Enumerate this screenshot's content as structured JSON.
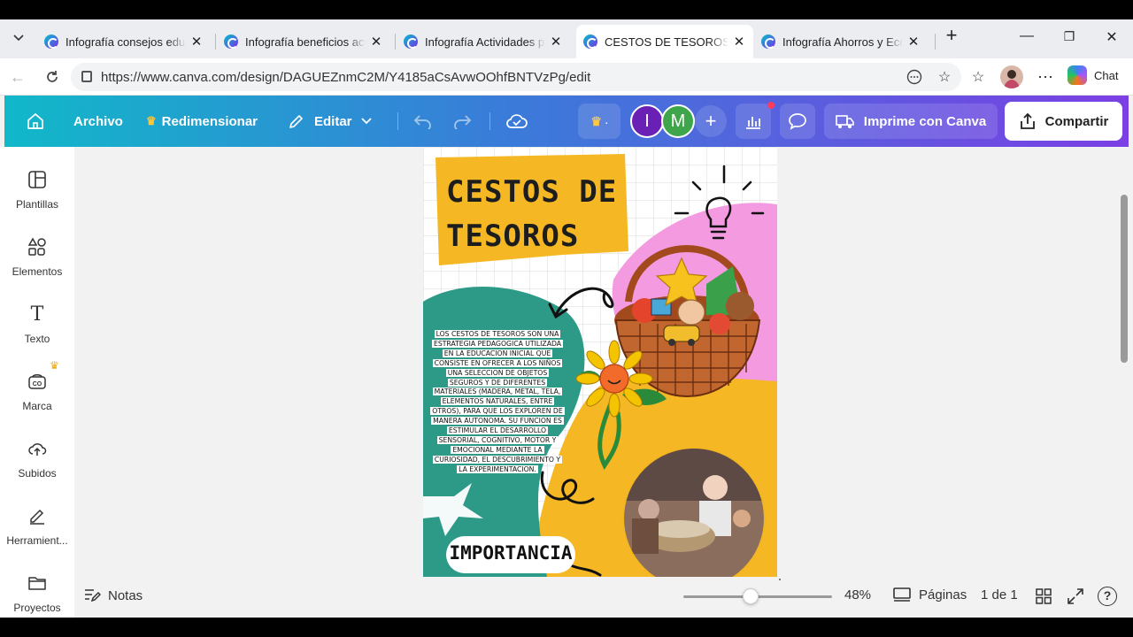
{
  "browser": {
    "tabs": [
      {
        "title": "Infografía consejos educa"
      },
      {
        "title": "Infografía beneficios activ"
      },
      {
        "title": "Infografía Actividades par"
      },
      {
        "title": "CESTOS DE TESOROS - Inf"
      },
      {
        "title": "Infografía Ahorros y Econ"
      }
    ],
    "active_tab_index": 3,
    "new_tab": "+",
    "url": "https://www.canva.com/design/DAGUEZnmC2M/Y4185aCsAvwOOhfBNTVzPg/edit",
    "chat_label": "Chat"
  },
  "canva": {
    "file_label": "Archivo",
    "resize_label": "Redimensionar",
    "edit_label": "Editar",
    "print_label": "Imprime con Canva",
    "share_label": "Compartir",
    "avatars": [
      "I",
      "M"
    ],
    "accent_colors": {
      "avatar_i": "#6a1fb5",
      "avatar_m": "#3fa54a",
      "brand_gradient_start": "#11b8c9",
      "brand_gradient_end": "#7b3fe4"
    }
  },
  "sidebar": {
    "items": [
      {
        "label": "Plantillas",
        "icon": "templates-icon"
      },
      {
        "label": "Elementos",
        "icon": "elements-icon"
      },
      {
        "label": "Texto",
        "icon": "text-icon"
      },
      {
        "label": "Marca",
        "icon": "brand-icon"
      },
      {
        "label": "Subidos",
        "icon": "upload-icon"
      },
      {
        "label": "Herramient...",
        "icon": "tools-icon"
      },
      {
        "label": "Proyectos",
        "icon": "folder-icon"
      }
    ]
  },
  "design": {
    "title_line1": "CESTOS DE",
    "title_line2": "TESOROS",
    "body_lines": [
      "LOS CESTOS DE TESOROS SON UNA",
      "ESTRATEGIA PEDAGOGICA UTILIZADA",
      "EN LA EDUCACION INICIAL QUE",
      "CONSISTE EN OFRECER A LOS NIÑOS",
      "UNA SELECCION DE OBJETOS",
      "SEGUROS Y DE DIFERENTES",
      "MATERIALES (MADERA, METAL, TELA,",
      "ELEMENTOS NATURALES, ENTRE",
      "OTROS), PARA QUE LOS EXPLOREN DE",
      "MANERA AUTONOMA. SU FUNCION ES",
      "ESTIMULAR EL DESARROLLO",
      "SENSORIAL, COGNITIVO, MOTOR Y",
      "EMOCIONAL MEDIANTE LA",
      "CURIOSIDAD, EL DESCUBRIMIENTO Y",
      "LA EXPERIMENTACION."
    ],
    "section_heading": "IMPORTANCIA"
  },
  "bottom": {
    "notes_label": "Notas",
    "zoom_value": "48%",
    "zoom_fraction": 0.45,
    "pages_label": "Páginas",
    "page_count": "1 de 1"
  }
}
